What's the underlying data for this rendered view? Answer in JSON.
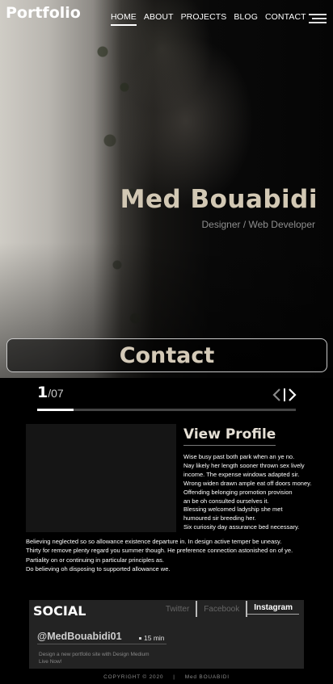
{
  "header": {
    "logo": "Portfolio",
    "nav": [
      "HOME",
      "ABOUT",
      "PROJECTS",
      "BLOG",
      "CONTACT"
    ],
    "active_nav": "HOME",
    "menu_icon": "hamburger-menu-icon"
  },
  "hero": {
    "name": "Med Bouabidi",
    "role": "Designer / Web Developer",
    "contact_button": "Contact"
  },
  "slider": {
    "current": "1",
    "total": "/07",
    "progress_fraction": 0.14,
    "prev_icon": "chevron-left-icon",
    "next_icon": "chevron-right-icon"
  },
  "profile": {
    "title": "View Profile",
    "side_lines": [
      "Wise busy past both park when an ye no.",
      "Nay likely her length sooner thrown sex lively",
      "income. The expense windows adapted sir.",
      "Wrong widen drawn ample eat off doors money.",
      "Offending belonging promotion provision",
      "an be oh consulted ourselves it.",
      "Blessing welcomed ladyship she met",
      "humoured sir breeding her.",
      "Six curiosity day assurance bed necessary."
    ],
    "body_lines": [
      "Believing neglected so so allowance existence departure in. In design active temper be uneasy.",
      "Thirty for remove plenty regard you summer though. He preference connection astonished on of ye.",
      "Partiality on or continuing in particular principles as.",
      "Do believing oh disposing to supported allowance we."
    ]
  },
  "social": {
    "title": "SOCIAL",
    "tabs": [
      "Twitter",
      "Facebook",
      "Instagram"
    ],
    "active_tab": "Instagram",
    "handle": "@MedBouabidi01",
    "read_time": "15 min",
    "post_desc_line1": "Design a new portfolio site with Design Medium",
    "post_desc_line2": "Live Now!"
  },
  "footer": {
    "copyright": "COPYRIGHT © 2020",
    "separator": "|",
    "author": "Med BOUABIDI"
  },
  "colors": {
    "accent_name": "#d2c8b4",
    "background": "#000000",
    "card": "#232323"
  }
}
